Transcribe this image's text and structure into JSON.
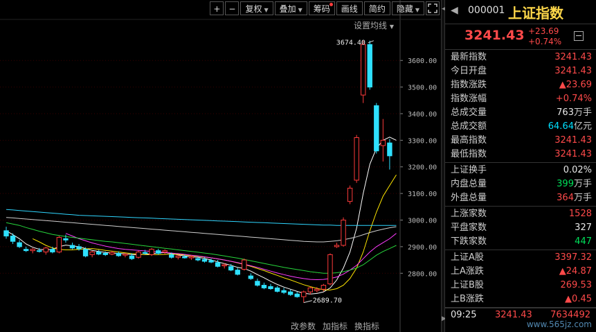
{
  "toolbar": {
    "plus": "+",
    "minus": "−",
    "fuquan": "复权",
    "diejia": "叠加",
    "chouma": "筹码",
    "huaxian": "画线",
    "jianyue": "简约",
    "yincang": "隐藏",
    "expand_icon": "expand-icon"
  },
  "ma_setting": "设置均线",
  "bottom_bar": [
    "改参数",
    "加指标",
    "换指标"
  ],
  "chart_data": {
    "type": "candlestick",
    "y_ticks": [
      "3600.00",
      "3500.00",
      "3400.00",
      "3300.00",
      "3200.00",
      "3100.00",
      "3000.00",
      "2900.00",
      "2800.00"
    ],
    "ylim": [
      2660,
      3710
    ],
    "annotations": [
      {
        "label": "3674.40",
        "value": 3674.4,
        "index": 56
      },
      {
        "label": "2689.70",
        "value": 2689.7,
        "index": 45
      }
    ],
    "candles": [
      {
        "o": 2960,
        "h": 2975,
        "l": 2930,
        "c": 2940
      },
      {
        "o": 2940,
        "h": 2950,
        "l": 2910,
        "c": 2920
      },
      {
        "o": 2915,
        "h": 2925,
        "l": 2895,
        "c": 2900
      },
      {
        "o": 2890,
        "h": 2900,
        "l": 2880,
        "c": 2885
      },
      {
        "o": 2885,
        "h": 2895,
        "l": 2875,
        "c": 2890
      },
      {
        "o": 2885,
        "h": 2895,
        "l": 2878,
        "c": 2882
      },
      {
        "o": 2880,
        "h": 2900,
        "l": 2870,
        "c": 2895
      },
      {
        "o": 2890,
        "h": 2900,
        "l": 2875,
        "c": 2880
      },
      {
        "o": 2880,
        "h": 2940,
        "l": 2875,
        "c": 2935
      },
      {
        "o": 2930,
        "h": 2945,
        "l": 2915,
        "c": 2925
      },
      {
        "o": 2905,
        "h": 2915,
        "l": 2890,
        "c": 2895
      },
      {
        "o": 2900,
        "h": 2910,
        "l": 2885,
        "c": 2892
      },
      {
        "o": 2890,
        "h": 2898,
        "l": 2860,
        "c": 2865
      },
      {
        "o": 2870,
        "h": 2885,
        "l": 2860,
        "c": 2880
      },
      {
        "o": 2880,
        "h": 2888,
        "l": 2868,
        "c": 2872
      },
      {
        "o": 2875,
        "h": 2882,
        "l": 2865,
        "c": 2870
      },
      {
        "o": 2872,
        "h": 2885,
        "l": 2868,
        "c": 2878
      },
      {
        "o": 2875,
        "h": 2882,
        "l": 2862,
        "c": 2866
      },
      {
        "o": 2868,
        "h": 2875,
        "l": 2860,
        "c": 2872
      },
      {
        "o": 2865,
        "h": 2875,
        "l": 2850,
        "c": 2855
      },
      {
        "o": 2860,
        "h": 2885,
        "l": 2855,
        "c": 2880
      },
      {
        "o": 2878,
        "h": 2888,
        "l": 2870,
        "c": 2875
      },
      {
        "o": 2870,
        "h": 2895,
        "l": 2865,
        "c": 2890
      },
      {
        "o": 2885,
        "h": 2892,
        "l": 2870,
        "c": 2875
      },
      {
        "o": 2880,
        "h": 2890,
        "l": 2872,
        "c": 2885
      },
      {
        "o": 2870,
        "h": 2878,
        "l": 2855,
        "c": 2860
      },
      {
        "o": 2860,
        "h": 2870,
        "l": 2852,
        "c": 2865
      },
      {
        "o": 2862,
        "h": 2870,
        "l": 2855,
        "c": 2858
      },
      {
        "o": 2858,
        "h": 2868,
        "l": 2850,
        "c": 2862
      },
      {
        "o": 2855,
        "h": 2862,
        "l": 2845,
        "c": 2850
      },
      {
        "o": 2852,
        "h": 2860,
        "l": 2840,
        "c": 2845
      },
      {
        "o": 2848,
        "h": 2855,
        "l": 2838,
        "c": 2842
      },
      {
        "o": 2840,
        "h": 2850,
        "l": 2822,
        "c": 2826
      },
      {
        "o": 2828,
        "h": 2838,
        "l": 2818,
        "c": 2832
      },
      {
        "o": 2825,
        "h": 2835,
        "l": 2808,
        "c": 2812
      },
      {
        "o": 2812,
        "h": 2820,
        "l": 2792,
        "c": 2796
      },
      {
        "o": 2815,
        "h": 2855,
        "l": 2810,
        "c": 2850
      },
      {
        "o": 2790,
        "h": 2800,
        "l": 2775,
        "c": 2780
      },
      {
        "o": 2770,
        "h": 2780,
        "l": 2750,
        "c": 2755
      },
      {
        "o": 2755,
        "h": 2765,
        "l": 2740,
        "c": 2745
      },
      {
        "o": 2750,
        "h": 2760,
        "l": 2738,
        "c": 2742
      },
      {
        "o": 2745,
        "h": 2752,
        "l": 2728,
        "c": 2732
      },
      {
        "o": 2735,
        "h": 2745,
        "l": 2722,
        "c": 2728
      },
      {
        "o": 2730,
        "h": 2738,
        "l": 2715,
        "c": 2720
      },
      {
        "o": 2722,
        "h": 2730,
        "l": 2708,
        "c": 2712
      },
      {
        "o": 2712,
        "h": 2735,
        "l": 2689.7,
        "c": 2730
      },
      {
        "o": 2730,
        "h": 2750,
        "l": 2720,
        "c": 2745
      },
      {
        "o": 2735,
        "h": 2748,
        "l": 2728,
        "c": 2740
      },
      {
        "o": 2740,
        "h": 2760,
        "l": 2732,
        "c": 2755
      },
      {
        "o": 2760,
        "h": 2875,
        "l": 2755,
        "c": 2870
      },
      {
        "o": 2900,
        "h": 2915,
        "l": 2895,
        "c": 2905
      },
      {
        "o": 2905,
        "h": 3010,
        "l": 2900,
        "c": 3000
      },
      {
        "o": 3070,
        "h": 3130,
        "l": 3060,
        "c": 3120
      },
      {
        "o": 3150,
        "h": 3320,
        "l": 3140,
        "c": 3310
      },
      {
        "o": 3470,
        "h": 3674.4,
        "l": 3440,
        "c": 3660
      },
      {
        "o": 3660,
        "h": 3674.4,
        "l": 3490,
        "c": 3500
      },
      {
        "o": 3430,
        "h": 3440,
        "l": 3250,
        "c": 3260
      },
      {
        "o": 3280,
        "h": 3380,
        "l": 3220,
        "c": 3300
      },
      {
        "o": 3290,
        "h": 3305,
        "l": 3190,
        "c": 3241.43
      }
    ],
    "ma_lines": [
      {
        "name": "ma-white-fast",
        "color": "#ffffff",
        "values": [
          2960,
          2945,
          2930,
          2910,
          2898,
          2890,
          2888,
          2890,
          2900,
          2906,
          2903,
          2900,
          2893,
          2886,
          2882,
          2878,
          2876,
          2875,
          2873,
          2870,
          2870,
          2871,
          2874,
          2876,
          2878,
          2874,
          2869,
          2865,
          2862,
          2860,
          2856,
          2850,
          2843,
          2836,
          2830,
          2822,
          2818,
          2808,
          2795,
          2783,
          2770,
          2758,
          2748,
          2740,
          2732,
          2725,
          2722,
          2724,
          2730,
          2745,
          2775,
          2820,
          2880,
          2970,
          3100,
          3210,
          3270,
          3300,
          3312,
          3300
        ]
      },
      {
        "name": "ma-yellow",
        "color": "#ffe600",
        "values": [
          null,
          null,
          null,
          null,
          2930,
          2918,
          2905,
          2895,
          2890,
          2888,
          2888,
          2890,
          2892,
          2893,
          2890,
          2886,
          2883,
          2880,
          2877,
          2874,
          2872,
          2870,
          2870,
          2870,
          2871,
          2872,
          2871,
          2869,
          2866,
          2864,
          2861,
          2858,
          2854,
          2850,
          2845,
          2839,
          2833,
          2826,
          2818,
          2810,
          2801,
          2792,
          2783,
          2775,
          2766,
          2757,
          2750,
          2743,
          2738,
          2737,
          2742,
          2755,
          2780,
          2820,
          2880,
          2960,
          3030,
          3090,
          3130,
          3170
        ]
      },
      {
        "name": "ma-magenta",
        "color": "#ff3cff",
        "values": [
          null,
          null,
          null,
          null,
          null,
          null,
          null,
          null,
          null,
          2950,
          2940,
          2930,
          2922,
          2914,
          2908,
          2902,
          2897,
          2893,
          2890,
          2888,
          2886,
          2884,
          2882,
          2880,
          2878,
          2876,
          2874,
          2871,
          2868,
          2865,
          2862,
          2858,
          2854,
          2850,
          2845,
          2840,
          2834,
          2828,
          2822,
          2815,
          2808,
          2801,
          2795,
          2789,
          2784,
          2780,
          2777,
          2776,
          2777,
          2780,
          2786,
          2797,
          2812,
          2830,
          2855,
          2880,
          2900,
          2915,
          2930,
          2950
        ]
      },
      {
        "name": "ma-green",
        "color": "#27d63c",
        "values": [
          2990,
          2985,
          2980,
          2972,
          2965,
          2958,
          2952,
          2946,
          2942,
          2938,
          2935,
          2932,
          2929,
          2926,
          2923,
          2920,
          2918,
          2915,
          2912,
          2909,
          2906,
          2903,
          2900,
          2897,
          2894,
          2891,
          2888,
          2885,
          2882,
          2879,
          2876,
          2873,
          2869,
          2865,
          2861,
          2857,
          2852,
          2847,
          2842,
          2837,
          2832,
          2827,
          2822,
          2818,
          2814,
          2810,
          2806,
          2803,
          2800,
          2800,
          2802,
          2806,
          2812,
          2820,
          2832,
          2850,
          2868,
          2882,
          2893,
          2905
        ]
      },
      {
        "name": "ma-gray",
        "color": "#cfcfcf",
        "values": [
          3010,
          3008,
          3006,
          3004,
          3002,
          3000,
          2998,
          2996,
          2994,
          2992,
          2990,
          2988,
          2986,
          2984,
          2982,
          2980,
          2978,
          2976,
          2974,
          2972,
          2970,
          2968,
          2966,
          2964,
          2962,
          2960,
          2958,
          2956,
          2954,
          2952,
          2950,
          2948,
          2946,
          2944,
          2942,
          2940,
          2938,
          2936,
          2934,
          2932,
          2930,
          2928,
          2926,
          2924,
          2922,
          2920,
          2919,
          2918,
          2918,
          2920,
          2922,
          2926,
          2931,
          2937,
          2945,
          2953,
          2960,
          2966,
          2971,
          2975
        ]
      },
      {
        "name": "ma-cyan",
        "color": "#2fd6ff",
        "values": [
          3040,
          3038,
          3036,
          3034,
          3032,
          3030,
          3028,
          3026,
          3024,
          3022,
          3020,
          3018,
          3017,
          3016,
          3015,
          3014,
          3013,
          3012,
          3011,
          3010,
          3009,
          3008,
          3007,
          3006,
          3005,
          3004,
          3003,
          3002,
          3001,
          3000,
          2999,
          2998,
          2997,
          2996,
          2995,
          2994,
          2993,
          2992,
          2991,
          2990,
          2989,
          2988,
          2987,
          2986,
          2985,
          2984,
          2983,
          2982,
          2981,
          2981,
          2980,
          2980,
          2980,
          2980,
          2980,
          2980,
          2980,
          2980,
          2980,
          2980
        ]
      }
    ]
  },
  "panel": {
    "code": "000001",
    "name": "上证指数",
    "price": "3241.43",
    "change": "+23.69",
    "change_pct": "+0.74%",
    "sec1": [
      {
        "label": "最新指数",
        "value": "3241.43",
        "color": "red"
      },
      {
        "label": "今日开盘",
        "value": "3241.43",
        "color": "red"
      },
      {
        "label": "指数涨跌",
        "value": "▲23.69",
        "color": "red"
      },
      {
        "label": "指数涨幅",
        "value": "+0.74%",
        "color": "red"
      },
      {
        "label": "总成交量",
        "value": "763",
        "unit": "万手",
        "color": "white"
      },
      {
        "label": "总成交额",
        "value": "64.64",
        "unit": "亿元",
        "color": "cyan"
      },
      {
        "label": "最高指数",
        "value": "3241.43",
        "color": "red"
      },
      {
        "label": "最低指数",
        "value": "3241.43",
        "color": "red"
      }
    ],
    "sec2": [
      {
        "label": "上证换手",
        "value": "0.02%",
        "color": "white"
      },
      {
        "label": "内盘总量",
        "value": "399",
        "unit": "万手",
        "color": "green"
      },
      {
        "label": "外盘总量",
        "value": "364",
        "unit": "万手",
        "color": "red"
      }
    ],
    "sec3": [
      {
        "label": "上涨家数",
        "value": "1528",
        "color": "red"
      },
      {
        "label": "平盘家数",
        "value": "327",
        "color": "white"
      },
      {
        "label": "下跌家数",
        "value": "447",
        "color": "green"
      }
    ],
    "sec4": [
      {
        "label": "上证A股",
        "value": "3397.32",
        "color": "red"
      },
      {
        "label": "上A涨跌",
        "value": "▲24.87",
        "color": "red"
      },
      {
        "label": "上证B股",
        "value": "269.53",
        "color": "red"
      },
      {
        "label": "上B涨跌",
        "value": "▲0.45",
        "color": "red"
      }
    ],
    "footer": {
      "time": "09:25",
      "price": "3241.43",
      "volume": "7634492"
    },
    "watermark": "www.565jz.com"
  }
}
